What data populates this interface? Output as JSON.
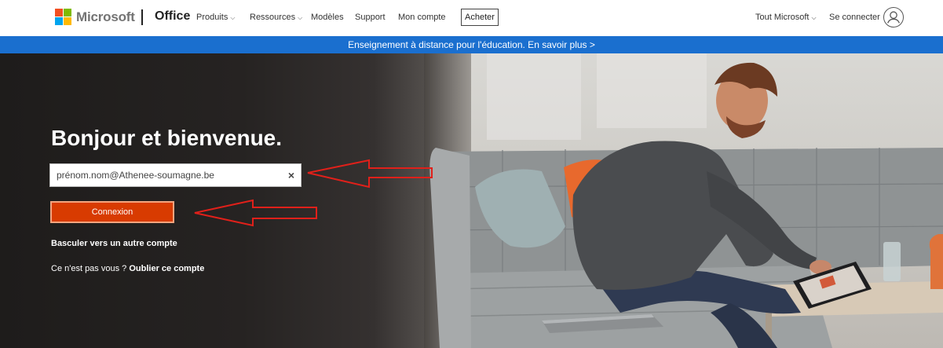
{
  "brand": {
    "name": "Microsoft",
    "product": "Office",
    "logo_colors": [
      "#f25022",
      "#7fba00",
      "#00a4ef",
      "#ffb900"
    ]
  },
  "nav": {
    "items": [
      {
        "label": "Produits",
        "dropdown": true
      },
      {
        "label": "Ressources",
        "dropdown": true
      },
      {
        "label": "Modèles",
        "dropdown": false
      },
      {
        "label": "Support",
        "dropdown": false
      },
      {
        "label": "Mon compte",
        "dropdown": false
      }
    ],
    "buy_label": "Acheter",
    "all_microsoft": "Tout Microsoft",
    "sign_in": "Se connecter"
  },
  "banner": {
    "text": "Enseignement à distance pour l'éducation. En savoir plus >",
    "color": "#1a6fcf"
  },
  "login": {
    "heading": "Bonjour et bienvenue.",
    "email_value": "prénom.nom@Athenee-soumagne.be",
    "clear_icon": "×",
    "connect_label": "Connexion",
    "connect_color": "#d83b01",
    "switch_account": "Basculer vers un autre compte",
    "not_you_prefix": "Ce n'est pas vous ?",
    "forget_account": "Oublier ce compte"
  },
  "annotation": {
    "arrow_color": "#e0201a"
  }
}
